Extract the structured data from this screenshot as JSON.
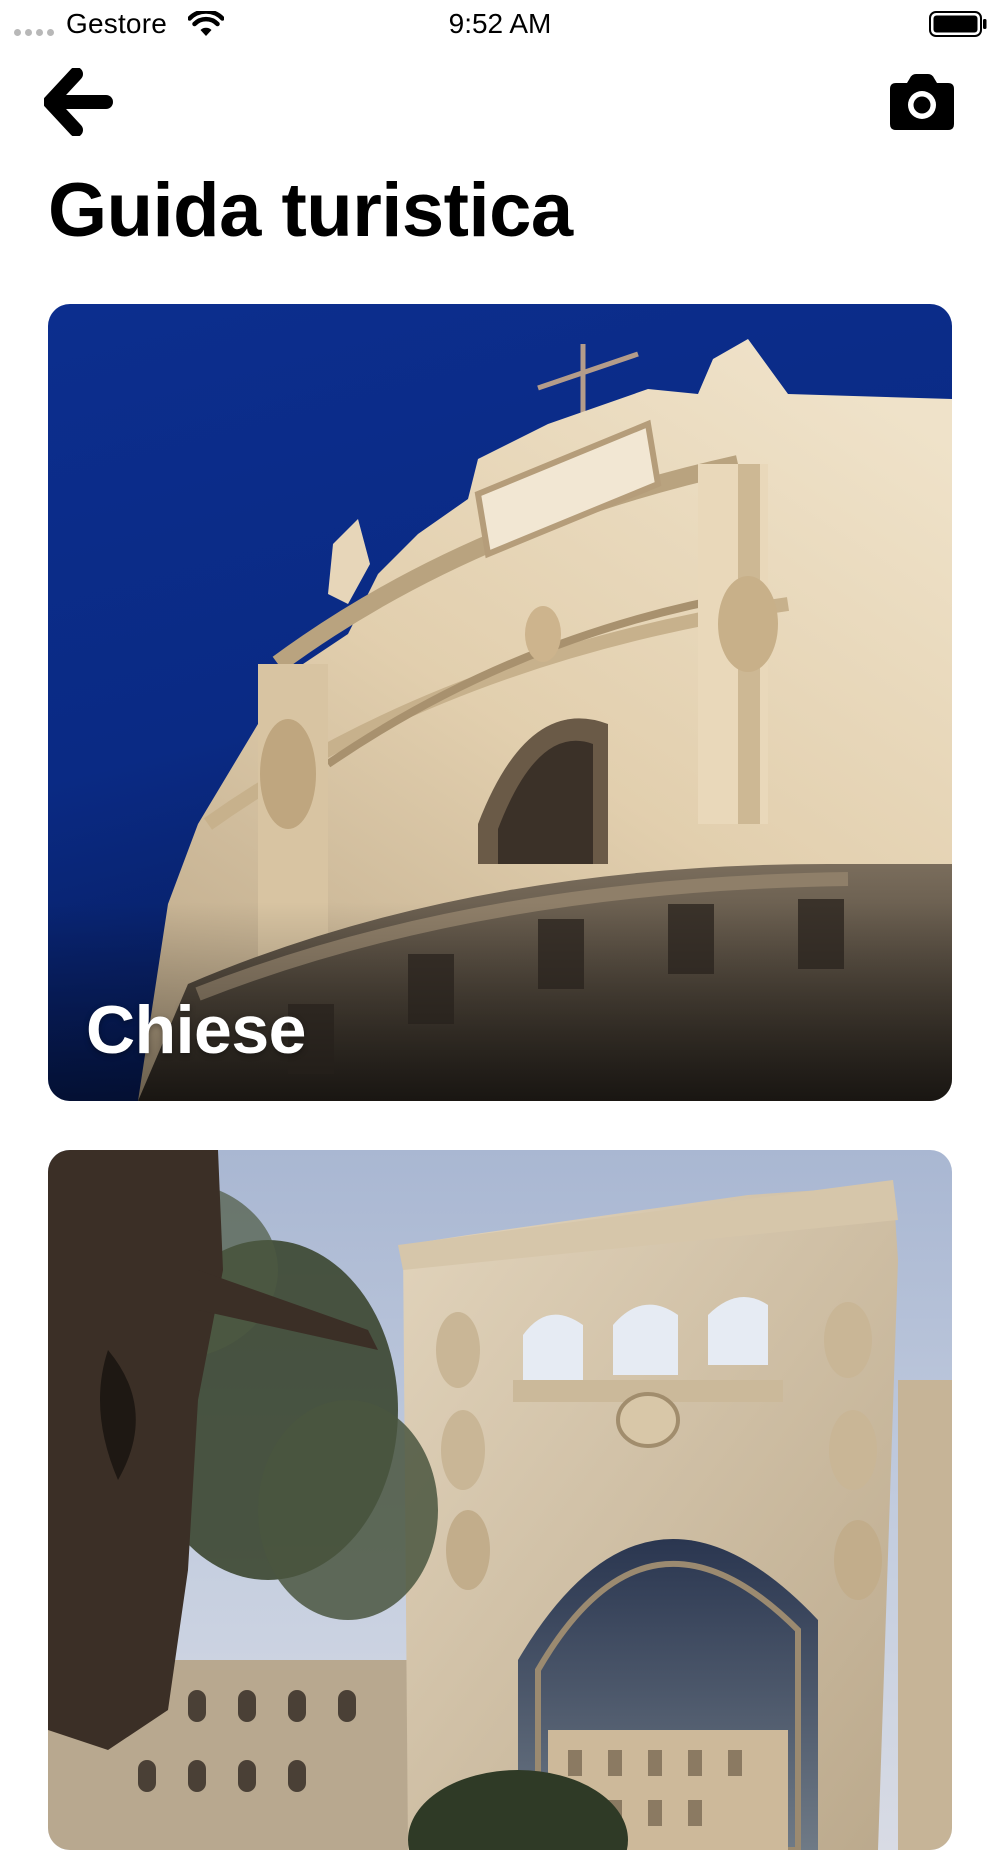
{
  "status_bar": {
    "carrier": "Gestore",
    "time": "9:52 AM",
    "icons": [
      "signal-dots-icon",
      "wifi-icon",
      "battery-icon"
    ]
  },
  "nav": {
    "back_icon": "arrow-left-icon",
    "camera_icon": "camera-icon"
  },
  "page": {
    "title": "Guida turistica"
  },
  "cards": [
    {
      "label": "Chiese",
      "image": "baroque-church-facade-photo"
    },
    {
      "label": "",
      "image": "triumphal-arch-with-olive-tree-photo"
    }
  ],
  "colors": {
    "background": "#ffffff",
    "text": "#000000",
    "card_label": "#ffffff",
    "sky_deep": "#0b2a8a"
  }
}
